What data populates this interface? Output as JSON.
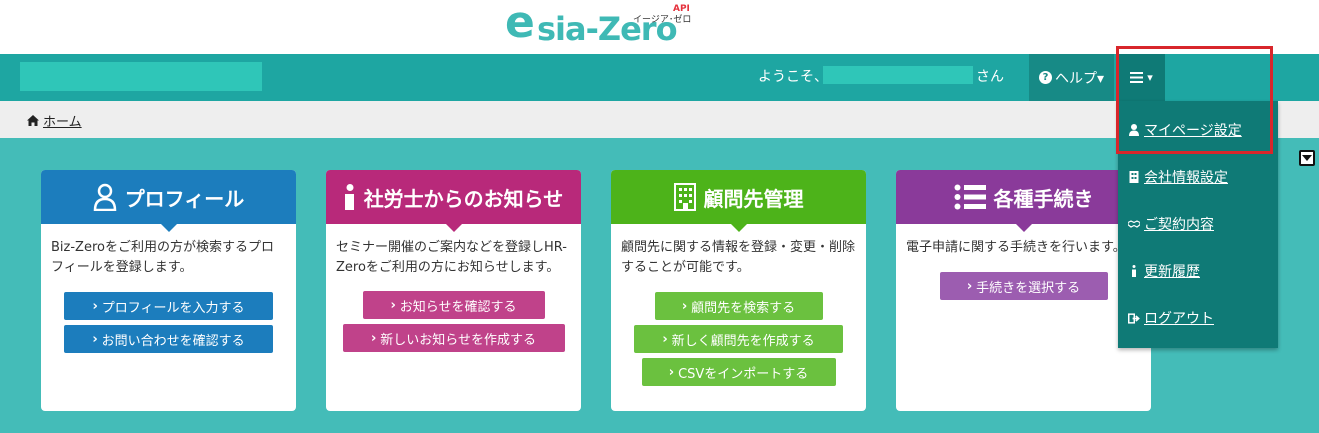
{
  "logo": {
    "e": "e",
    "rest": "sia-Zero",
    "api": "API",
    "kana": "イージア･ゼロ"
  },
  "header": {
    "welcome": "ようこそ、",
    "san": "さん",
    "help_label": "ヘルプ▾",
    "menu_caret": "▾"
  },
  "breadcrumb": {
    "home": "ホーム"
  },
  "panels": [
    {
      "title": "プロフィール",
      "desc": "Biz-Zeroをご利用の方が検索するプロフィールを登録します。",
      "buttons": [
        "プロフィールを入力する",
        "お問い合わせを確認する"
      ]
    },
    {
      "title": "社労士からのお知らせ",
      "desc": "セミナー開催のご案内などを登録しHR-Zeroをご利用の方にお知らせします。",
      "buttons": [
        "お知らせを確認する",
        "新しいお知らせを作成する"
      ]
    },
    {
      "title": "顧問先管理",
      "desc": "顧問先に関する情報を登録・変更・削除することが可能です。",
      "buttons": [
        "顧問先を検索する",
        "新しく顧問先を作成する",
        "CSVをインポートする"
      ]
    },
    {
      "title": "各種手続き",
      "desc": "電子申請に関する手続きを行います。",
      "buttons": [
        "手続きを選択する"
      ]
    }
  ],
  "dropdown": {
    "items": [
      "マイページ設定",
      "会社情報設定",
      "ご契約内容",
      "更新履歴",
      "ログアウト"
    ]
  },
  "colors": {
    "teal_bg": "#44bcb8",
    "navbar": "#1ea6a2",
    "profile": "#1c7dbd",
    "notice": "#b8297a",
    "client": "#4db31a",
    "procedure": "#8a3a9a",
    "highlight": "#d8262b"
  }
}
